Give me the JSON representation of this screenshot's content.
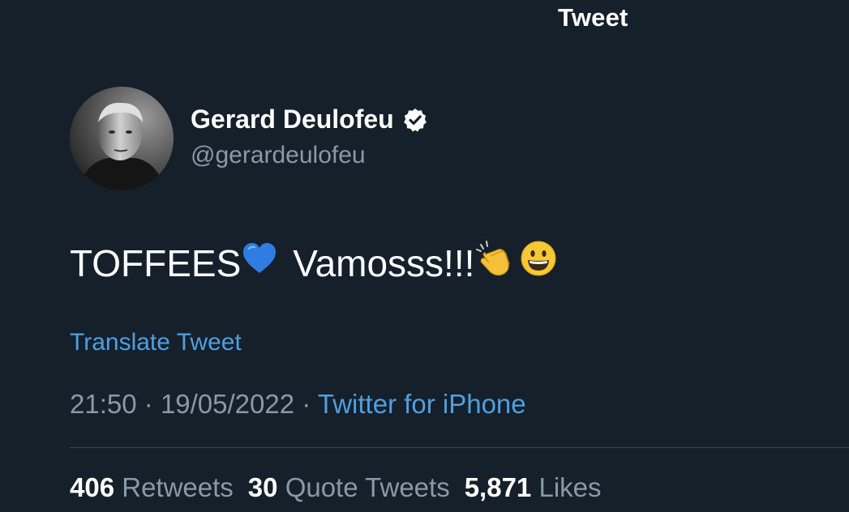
{
  "header": {
    "title": "Tweet"
  },
  "author": {
    "display_name": "Gerard Deulofeu",
    "handle": "@gerardeulofeu",
    "verified_icon": "verified-badge-icon"
  },
  "tweet": {
    "text_part1": "TOFFEES",
    "text_part2": "Vamosss!!!",
    "emojis": [
      "blue-heart-icon",
      "clapping-hands-icon",
      "grinning-face-icon"
    ],
    "translate_label": "Translate Tweet",
    "time": "21:50",
    "date": "19/05/2022",
    "separator": "·",
    "source": "Twitter for iPhone"
  },
  "stats": {
    "retweets_count": "406",
    "retweets_label": "Retweets",
    "quotes_count": "30",
    "quotes_label": "Quote Tweets",
    "likes_count": "5,871",
    "likes_label": "Likes"
  },
  "colors": {
    "background": "#15202b",
    "link": "#4f9fe0",
    "secondary_text": "#8b98a5",
    "divider": "#38444d"
  }
}
